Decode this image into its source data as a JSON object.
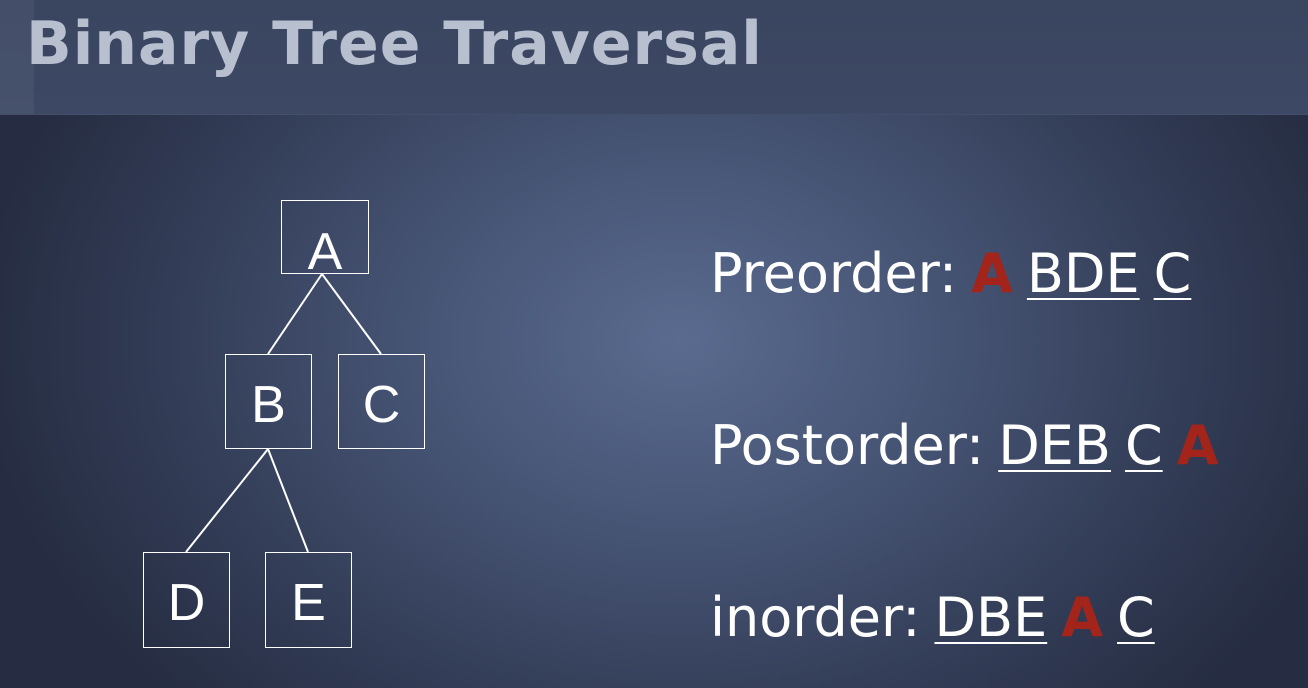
{
  "title": "Binary Tree Traversal",
  "colors": {
    "background": "#4a5878",
    "title_text": "#b8c0cf",
    "root_highlight": "#a3241a",
    "text": "#ffffff"
  },
  "tree": {
    "nodes": [
      {
        "id": "A",
        "label": "A"
      },
      {
        "id": "B",
        "label": "B"
      },
      {
        "id": "C",
        "label": "C"
      },
      {
        "id": "D",
        "label": "D"
      },
      {
        "id": "E",
        "label": "E"
      }
    ],
    "edges": [
      [
        "A",
        "B"
      ],
      [
        "A",
        "C"
      ],
      [
        "B",
        "D"
      ],
      [
        "B",
        "E"
      ]
    ]
  },
  "traversals": [
    {
      "label": "Preorder:",
      "parts": [
        {
          "text": "A",
          "kind": "root"
        },
        {
          "text": "BDE",
          "kind": "subtree"
        },
        {
          "text": "C",
          "kind": "subtree"
        }
      ]
    },
    {
      "label": "Postorder:",
      "parts": [
        {
          "text": "DEB",
          "kind": "subtree"
        },
        {
          "text": "C",
          "kind": "subtree"
        },
        {
          "text": "A",
          "kind": "root"
        }
      ]
    },
    {
      "label": "inorder:",
      "parts": [
        {
          "text": "DBE",
          "kind": "subtree"
        },
        {
          "text": "A",
          "kind": "root"
        },
        {
          "text": "C",
          "kind": "subtree"
        }
      ]
    }
  ]
}
